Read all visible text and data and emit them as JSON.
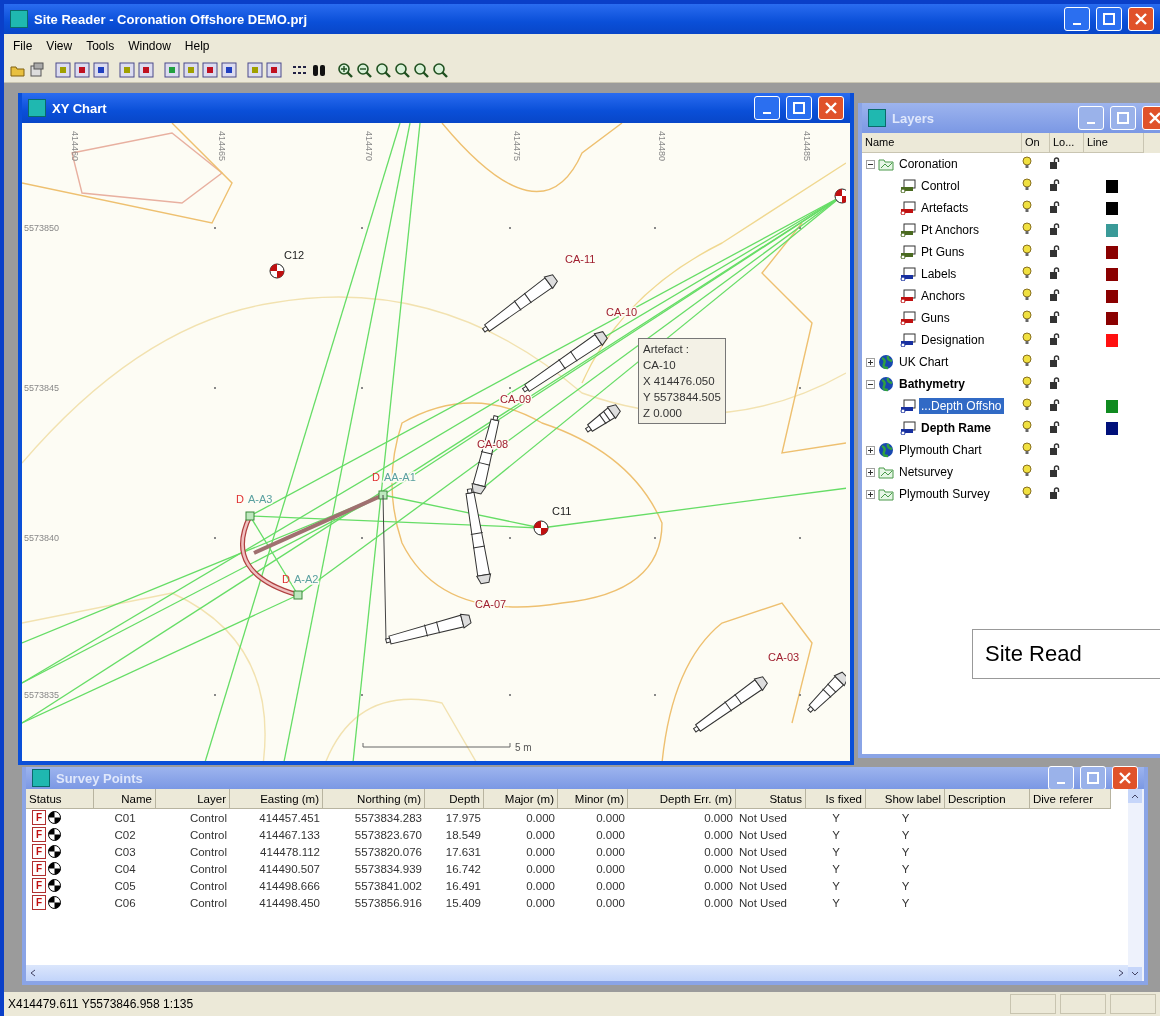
{
  "window": {
    "title": "Site Reader - Coronation Offshore DEMO.prj"
  },
  "menu": [
    "File",
    "View",
    "Tools",
    "Window",
    "Help"
  ],
  "chart_window": {
    "title": "XY Chart",
    "x_labels": [
      "414460",
      "414465",
      "414470",
      "414475",
      "414480",
      "414485"
    ],
    "y_labels": [
      "5573850",
      "5573845",
      "5573840",
      "5573835"
    ],
    "control_points": [
      "C12",
      "C11"
    ],
    "artefacts": [
      "CA-11",
      "CA-10",
      "CA-09",
      "CA-08",
      "CA-07",
      "CA-03"
    ],
    "anchor_points": [
      {
        "flag": "D",
        "name": "AA-A1"
      },
      {
        "flag": "D",
        "name": "A-A3"
      },
      {
        "flag": "D",
        "name": "A-A2"
      }
    ],
    "tooltip": [
      "Artefact :",
      "CA-10",
      "X 414476.050",
      "Y 5573844.505",
      "Z 0.000"
    ],
    "scale_label": "5 m"
  },
  "layers": {
    "title": "Layers",
    "columns": [
      "Name",
      "On",
      "Lo...",
      "Line"
    ],
    "items": [
      {
        "name": "Coronation",
        "kind": "group",
        "expanded": true,
        "bold": false,
        "selected": false,
        "on": true,
        "locked": false,
        "children": [
          {
            "name": "Control",
            "kind": "points",
            "bold": false,
            "selected": false,
            "on": true,
            "locked": false,
            "color": "#000000"
          },
          {
            "name": "Artefacts",
            "kind": "shapes",
            "bold": false,
            "selected": false,
            "on": true,
            "locked": false,
            "color": "#000000"
          },
          {
            "name": "Pt Anchors",
            "kind": "points",
            "bold": false,
            "selected": false,
            "on": true,
            "locked": false,
            "color": "#3a9a98"
          },
          {
            "name": "Pt Guns",
            "kind": "points",
            "bold": false,
            "selected": false,
            "on": true,
            "locked": false,
            "color": "#8a0000"
          },
          {
            "name": "Labels",
            "kind": "labels",
            "bold": false,
            "selected": false,
            "on": true,
            "locked": false,
            "color": "#8a0000"
          },
          {
            "name": "Anchors",
            "kind": "shapes",
            "bold": false,
            "selected": false,
            "on": true,
            "locked": false,
            "color": "#8a0000"
          },
          {
            "name": "Guns",
            "kind": "shapes",
            "bold": false,
            "selected": false,
            "on": true,
            "locked": false,
            "color": "#8a0000"
          },
          {
            "name": "Designation",
            "kind": "labels",
            "bold": false,
            "selected": false,
            "on": true,
            "locked": false,
            "color": "#ff1010"
          }
        ]
      },
      {
        "name": "UK Chart",
        "kind": "chart",
        "expanded": false,
        "bold": false,
        "selected": false,
        "on": true,
        "locked": false
      },
      {
        "name": "Bathymetry",
        "kind": "chart",
        "expanded": true,
        "bold": true,
        "selected": false,
        "on": true,
        "locked": false,
        "children": [
          {
            "name": "...Depth Offsho",
            "kind": "labels",
            "bold": false,
            "selected": true,
            "on": true,
            "locked": false,
            "color": "#108a20"
          },
          {
            "name": "Depth Rame",
            "kind": "labels",
            "bold": true,
            "selected": false,
            "on": true,
            "locked": false,
            "color": "#00107a"
          }
        ]
      },
      {
        "name": "Plymouth Chart",
        "kind": "chart",
        "expanded": false,
        "bold": false,
        "selected": false,
        "on": true,
        "locked": false
      },
      {
        "name": "Netsurvey",
        "kind": "group",
        "expanded": false,
        "bold": false,
        "selected": false,
        "on": true,
        "locked": false
      },
      {
        "name": "Plymouth Survey",
        "kind": "group",
        "expanded": false,
        "bold": false,
        "selected": false,
        "on": true,
        "locked": false
      }
    ]
  },
  "overlay_label": "Site Read",
  "survey": {
    "title": "Survey Points",
    "columns": [
      "Status",
      "Name",
      "Layer",
      "Easting (m)",
      "Northing (m)",
      "Depth",
      "Major (m)",
      "Minor (m)",
      "Depth Err. (m)",
      "Status",
      "Is fixed",
      "Show label",
      "Description",
      "Dive referer"
    ],
    "rows": [
      {
        "cells": [
          "F",
          "C01",
          "Control",
          "414457.451",
          "5573834.283",
          "17.975",
          "0.000",
          "0.000",
          "0.000",
          "Not Used",
          "Y",
          "Y"
        ]
      },
      {
        "cells": [
          "F",
          "C02",
          "Control",
          "414467.133",
          "5573823.670",
          "18.549",
          "0.000",
          "0.000",
          "0.000",
          "Not Used",
          "Y",
          "Y"
        ]
      },
      {
        "cells": [
          "F",
          "C03",
          "Control",
          "414478.112",
          "5573820.076",
          "17.631",
          "0.000",
          "0.000",
          "0.000",
          "Not Used",
          "Y",
          "Y"
        ]
      },
      {
        "cells": [
          "F",
          "C04",
          "Control",
          "414490.507",
          "5573834.939",
          "16.742",
          "0.000",
          "0.000",
          "0.000",
          "Not Used",
          "Y",
          "Y"
        ]
      },
      {
        "cells": [
          "F",
          "C05",
          "Control",
          "414498.666",
          "5573841.002",
          "16.491",
          "0.000",
          "0.000",
          "0.000",
          "Not Used",
          "Y",
          "Y"
        ]
      },
      {
        "cells": [
          "F",
          "C06",
          "Control",
          "414498.450",
          "5573856.916",
          "15.409",
          "0.000",
          "0.000",
          "0.000",
          "Not Used",
          "Y",
          "Y"
        ]
      }
    ]
  },
  "status_bar": "X414479.611  Y5573846.958  1:135"
}
